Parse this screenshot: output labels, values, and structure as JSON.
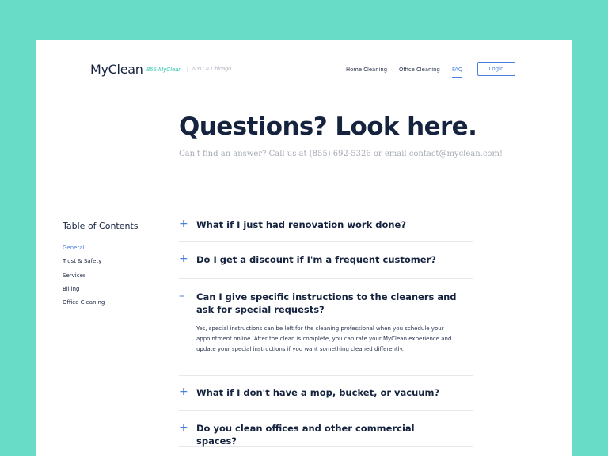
{
  "header": {
    "logo": "MyClean",
    "phone": "855-MyClean",
    "separator": "|",
    "cities": "NYC & Chicago",
    "nav": [
      {
        "label": "Home Cleaning"
      },
      {
        "label": "Office Cleaning"
      },
      {
        "label": "FAQ",
        "active": true
      }
    ],
    "login_label": "Login"
  },
  "hero": {
    "title": "Questions? Look here.",
    "subtitle": "Can't find an answer? Call us at (855) 692-5326 or email contact@myclean.com!"
  },
  "toc": {
    "title": "Table of Contents",
    "items": [
      {
        "label": "General",
        "active": true
      },
      {
        "label": "Trust & Safety"
      },
      {
        "label": "Services"
      },
      {
        "label": "Billing"
      },
      {
        "label": "Office Cleaning"
      }
    ]
  },
  "faq": [
    {
      "icon": "+",
      "question": "What if I just had renovation work done?"
    },
    {
      "icon": "+",
      "question": "Do I get a discount if I'm a frequent customer?"
    },
    {
      "icon": "–",
      "question": "Can I give specific instructions to the cleaners and ask for special requests?",
      "answer": "Yes, special instructions can be left for the cleaning professional when you schedule your appointment online. After the clean is complete, you can rate your MyClean experience and update your special instructions if you want something cleaned differently."
    },
    {
      "icon": "+",
      "question": "What if I don't have a mop, bucket, or vacuum?"
    },
    {
      "icon": "+",
      "question": "Do you clean offices and other commercial spaces?"
    }
  ],
  "colors": {
    "background": "#68dcc6",
    "accent": "#4a7fe0",
    "text": "#16233f"
  }
}
